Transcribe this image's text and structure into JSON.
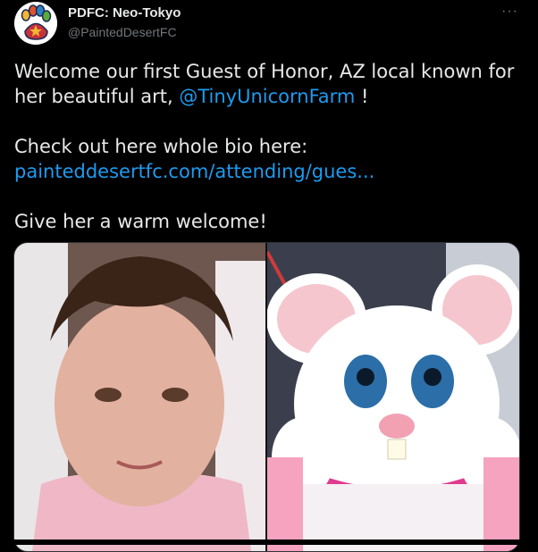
{
  "author": {
    "display_name": "PDFC: Neo-Tokyo",
    "handle": "@PaintedDesertFC",
    "avatar_icon": "paw-print-icon"
  },
  "more_label": "···",
  "tweet": {
    "line1_prefix": "Welcome our first Guest of Honor, AZ local known for her beautiful art, ",
    "mention": "@TinyUnicornFarm",
    "line1_suffix": " !",
    "line2": "Check out here whole bio here:",
    "link": "painteddesertfc.com/attending/gues...",
    "line3": "Give her a warm welcome!"
  },
  "colors": {
    "background": "#000000",
    "text": "#e7e9ea",
    "secondary": "#71767b",
    "link": "#1d9bf0"
  }
}
